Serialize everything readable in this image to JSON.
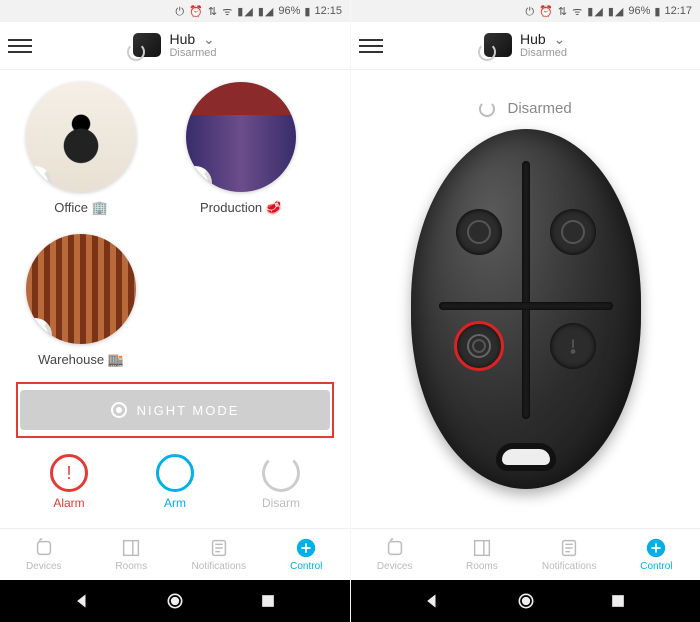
{
  "status": {
    "icons": "⏻ ⏰ ⇅ ᯤ ▮◢ ▮◢",
    "battery": "96%",
    "time_left": "12:15",
    "time_right": "12:17"
  },
  "header": {
    "title": "Hub",
    "subtitle": "Disarmed"
  },
  "rooms": [
    {
      "label": "Office 🏢"
    },
    {
      "label": "Production 🥩"
    },
    {
      "label": "Warehouse 🏬"
    }
  ],
  "night_mode": {
    "label": "NIGHT MODE"
  },
  "actions": {
    "alarm": "Alarm",
    "arm": "Arm",
    "disarm": "Disarm"
  },
  "tabs": {
    "devices": "Devices",
    "rooms": "Rooms",
    "notifications": "Notifications",
    "control": "Control"
  },
  "right": {
    "status": "Disarmed"
  }
}
